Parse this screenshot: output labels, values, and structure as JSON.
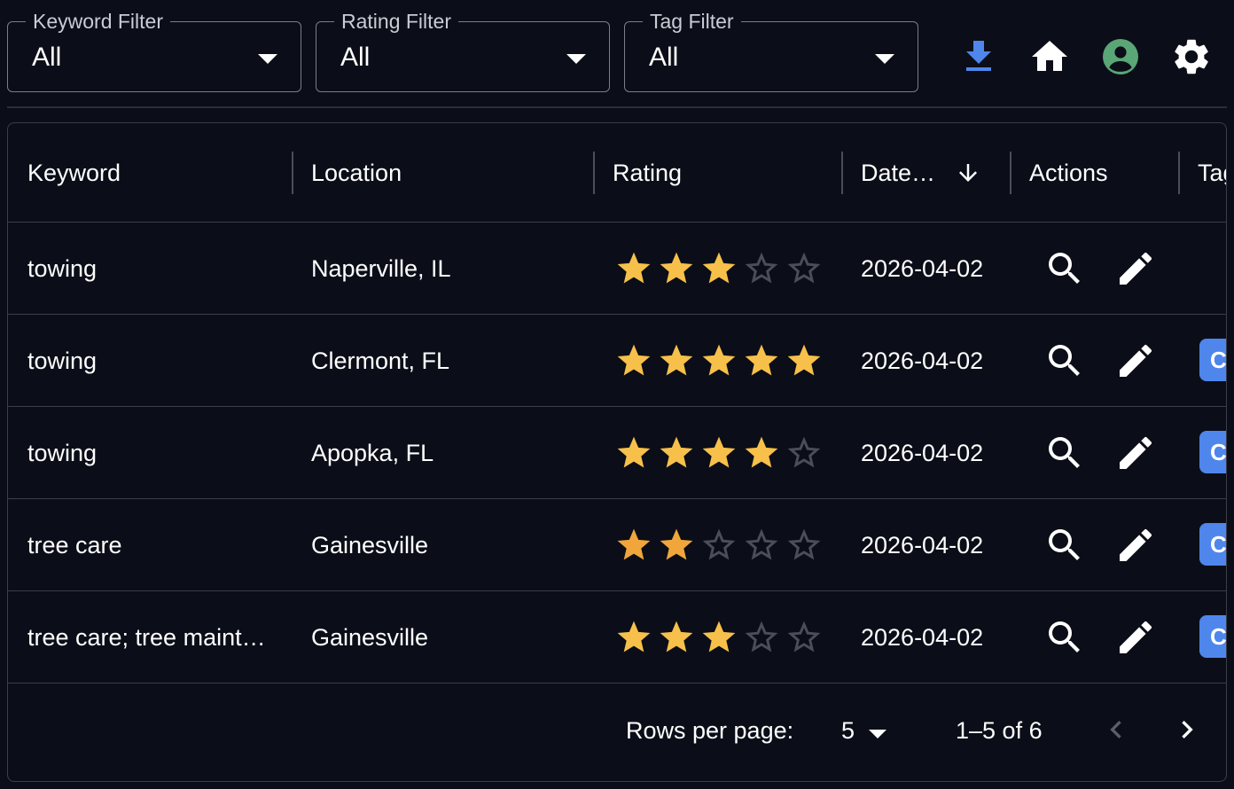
{
  "filters": [
    {
      "label": "Keyword Filter",
      "value": "All"
    },
    {
      "label": "Rating Filter",
      "value": "All"
    },
    {
      "label": "Tag Filter",
      "value": "All"
    }
  ],
  "toolbar": {
    "download_icon": "download-icon",
    "home_icon": "home-icon",
    "account_icon": "account-circle-icon",
    "settings_icon": "gear-icon",
    "download_color": "#4f86ec",
    "account_color": "#5aa676"
  },
  "table": {
    "columns": [
      "Keyword",
      "Location",
      "Rating",
      "Date…",
      "Actions",
      "Tag"
    ],
    "sort_icon": "arrow-down-icon",
    "rows": [
      {
        "keyword": "towing",
        "location": "Naperville, IL",
        "rating": 3,
        "date": "2026-04-02",
        "tag": ""
      },
      {
        "keyword": "towing",
        "location": "Clermont, FL",
        "rating": 5,
        "date": "2026-04-02",
        "tag": "C"
      },
      {
        "keyword": "towing",
        "location": "Apopka, FL",
        "rating": 4,
        "date": "2026-04-02",
        "tag": "C"
      },
      {
        "keyword": "tree care",
        "location": "Gainesville",
        "rating": 2,
        "date": "2026-04-02",
        "tag": "C"
      },
      {
        "keyword": "tree care; tree maint…",
        "location": "Gainesville",
        "rating": 3,
        "date": "2026-04-02",
        "tag": "C"
      }
    ],
    "star_color": "#f7c04a",
    "star_color_low": "#f0a63a",
    "empty_star_color": "#4a4e5a",
    "tag_color": "#4f86ec"
  },
  "pagination": {
    "rows_per_page_label": "Rows per page:",
    "rows_per_page_value": "5",
    "range_text": "1–5 of 6"
  }
}
